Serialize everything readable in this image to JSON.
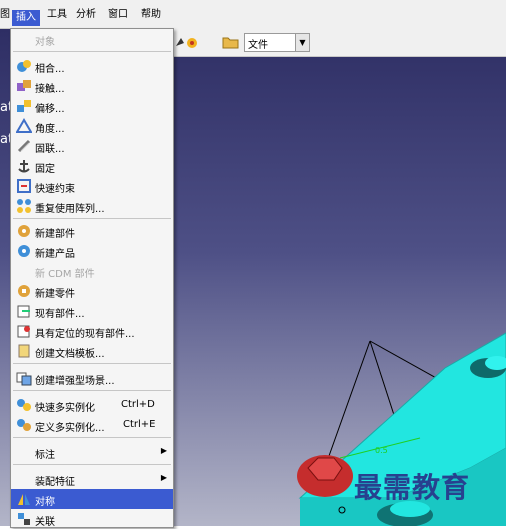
{
  "menubar": {
    "items": [
      {
        "label": "图"
      },
      {
        "label": "插入"
      },
      {
        "label": "工具"
      },
      {
        "label": "分析"
      },
      {
        "label": "窗口"
      },
      {
        "label": "帮助"
      }
    ]
  },
  "toolbar": {
    "combo_value": "文件"
  },
  "viewport": {
    "cut_text_1": "att",
    "cut_text_2": "att",
    "annotation": "0.5",
    "watermark": "最需教育"
  },
  "insert_menu": {
    "items": [
      {
        "label": "对象",
        "enabled": false
      },
      {
        "label": "相合...",
        "icon": "coincidence-icon"
      },
      {
        "label": "接触...",
        "icon": "contact-icon"
      },
      {
        "label": "偏移...",
        "icon": "offset-icon"
      },
      {
        "label": "角度...",
        "icon": "angle-icon"
      },
      {
        "label": "固联...",
        "icon": "fix-together-icon"
      },
      {
        "label": "固定",
        "icon": "anchor-icon"
      },
      {
        "label": "快速约束",
        "icon": "quick-constraint-icon"
      },
      {
        "label": "重复使用阵列...",
        "icon": "reuse-pattern-icon"
      },
      {
        "label": "新建部件",
        "icon": "new-component-icon"
      },
      {
        "label": "新建产品",
        "icon": "new-product-icon"
      },
      {
        "label": "新 CDM 部件",
        "enabled": false
      },
      {
        "label": "新建零件",
        "icon": "new-part-icon"
      },
      {
        "label": "现有部件...",
        "icon": "existing-component-icon"
      },
      {
        "label": "具有定位的现有部件...",
        "icon": "positioned-component-icon"
      },
      {
        "label": "创建文档模板...",
        "icon": "document-template-icon"
      },
      {
        "label": "创建增强型场景...",
        "icon": "enhanced-scene-icon"
      },
      {
        "label": "快速多实例化",
        "shortcut": "Ctrl+D",
        "icon": "fast-multi-instantiation-icon"
      },
      {
        "label": "定义多实例化...",
        "shortcut": "Ctrl+E",
        "icon": "define-multi-instantiation-icon"
      },
      {
        "label": "标注"
      },
      {
        "label": "装配特征"
      },
      {
        "label": "对称",
        "icon": "symmetry-icon"
      },
      {
        "label": "关联",
        "icon": "associate-icon"
      }
    ]
  }
}
